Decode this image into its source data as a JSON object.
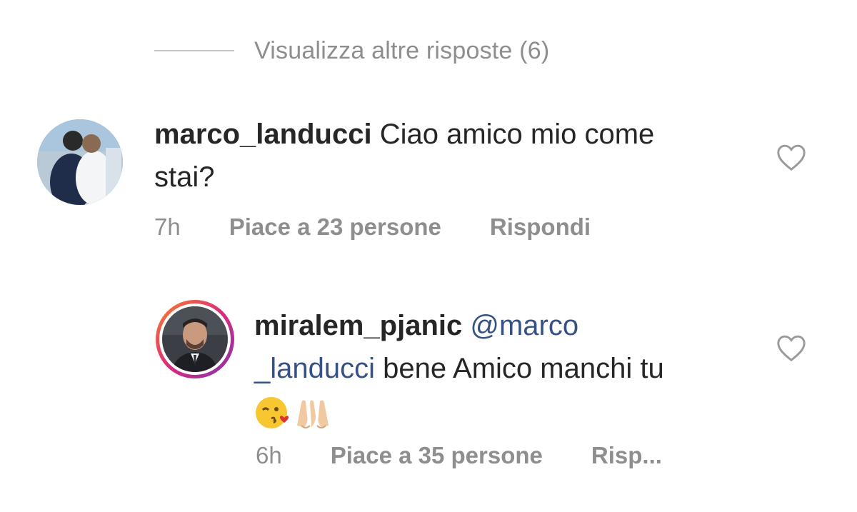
{
  "more_replies": {
    "label": "Visualizza altre risposte (6)"
  },
  "comments": [
    {
      "username": "marco_landucci",
      "text_line1": "Ciao amico mio come",
      "text_line2": "stai?",
      "time": "7h",
      "likes": "Piace a 23 persone",
      "reply": "Rispondi"
    },
    {
      "username": "miralem_pjanic",
      "mention_part1": "@marco",
      "mention_part2": "_landucci",
      "text": "bene Amico manchi tu",
      "emojis": [
        "kiss-wink-emoji",
        "folded-hands-emoji"
      ],
      "time": "6h",
      "likes": "Piace a 35 persone",
      "reply": "Risp..."
    }
  ],
  "colors": {
    "secondary_text": "#8e8e8e",
    "primary_text": "#262626",
    "mention": "#385185",
    "story_ring": "#e1306c"
  }
}
